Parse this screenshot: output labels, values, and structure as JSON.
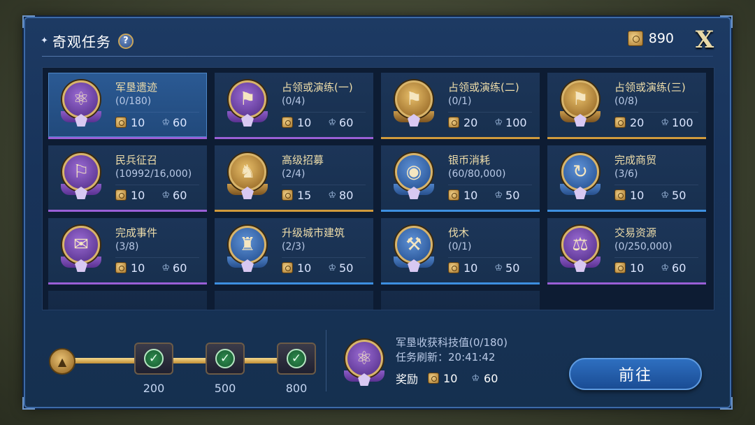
{
  "header": {
    "title": "奇观任务",
    "help_icon": "question-icon",
    "currency_value": "890",
    "close_label": "X"
  },
  "tasks": [
    {
      "name": "军垦遗迹",
      "progress": "(0/180)",
      "reward_coin": "10",
      "reward_exp": "60",
      "color": "purple",
      "icon": "⚛"
    },
    {
      "name": "占领或演练(一)",
      "progress": "(0/4)",
      "reward_coin": "10",
      "reward_exp": "60",
      "color": "purple",
      "icon": "⚑"
    },
    {
      "name": "占领或演练(二)",
      "progress": "(0/1)",
      "reward_coin": "20",
      "reward_exp": "100",
      "color": "gold",
      "icon": "⚑"
    },
    {
      "name": "占领或演练(三)",
      "progress": "(0/8)",
      "reward_coin": "20",
      "reward_exp": "100",
      "color": "gold",
      "icon": "⚑"
    },
    {
      "name": "民兵征召",
      "progress": "(10992/16,000)",
      "reward_coin": "10",
      "reward_exp": "60",
      "color": "purple",
      "icon": "⚐"
    },
    {
      "name": "高级招募",
      "progress": "(2/4)",
      "reward_coin": "15",
      "reward_exp": "80",
      "color": "gold",
      "icon": "♞"
    },
    {
      "name": "银币消耗",
      "progress": "(60/80,000)",
      "reward_coin": "10",
      "reward_exp": "50",
      "color": "blue",
      "icon": "◉"
    },
    {
      "name": "完成商贸",
      "progress": "(3/6)",
      "reward_coin": "10",
      "reward_exp": "50",
      "color": "blue",
      "icon": "↻"
    },
    {
      "name": "完成事件",
      "progress": "(3/8)",
      "reward_coin": "10",
      "reward_exp": "60",
      "color": "purple",
      "icon": "✉"
    },
    {
      "name": "升级城市建筑",
      "progress": "(2/3)",
      "reward_coin": "10",
      "reward_exp": "50",
      "color": "blue",
      "icon": "♜"
    },
    {
      "name": "伐木",
      "progress": "(0/1)",
      "reward_coin": "10",
      "reward_exp": "50",
      "color": "blue",
      "icon": "⚒"
    },
    {
      "name": "交易资源",
      "progress": "(0/250,000)",
      "reward_coin": "10",
      "reward_exp": "60",
      "color": "purple",
      "icon": "⚖"
    }
  ],
  "milestones": [
    {
      "value": "200"
    },
    {
      "value": "500"
    },
    {
      "value": "800"
    }
  ],
  "detail": {
    "title": "军垦收获科技值(0/180)",
    "refresh": "任务刷新：20:41:42",
    "reward_label": "奖励",
    "reward_coin": "10",
    "reward_exp": "60"
  },
  "go_button": "前往",
  "colors": {
    "purple": "#9a5fd6",
    "gold": "#d09a3c",
    "blue": "#3d8fe0",
    "panel": "#1b3860"
  }
}
